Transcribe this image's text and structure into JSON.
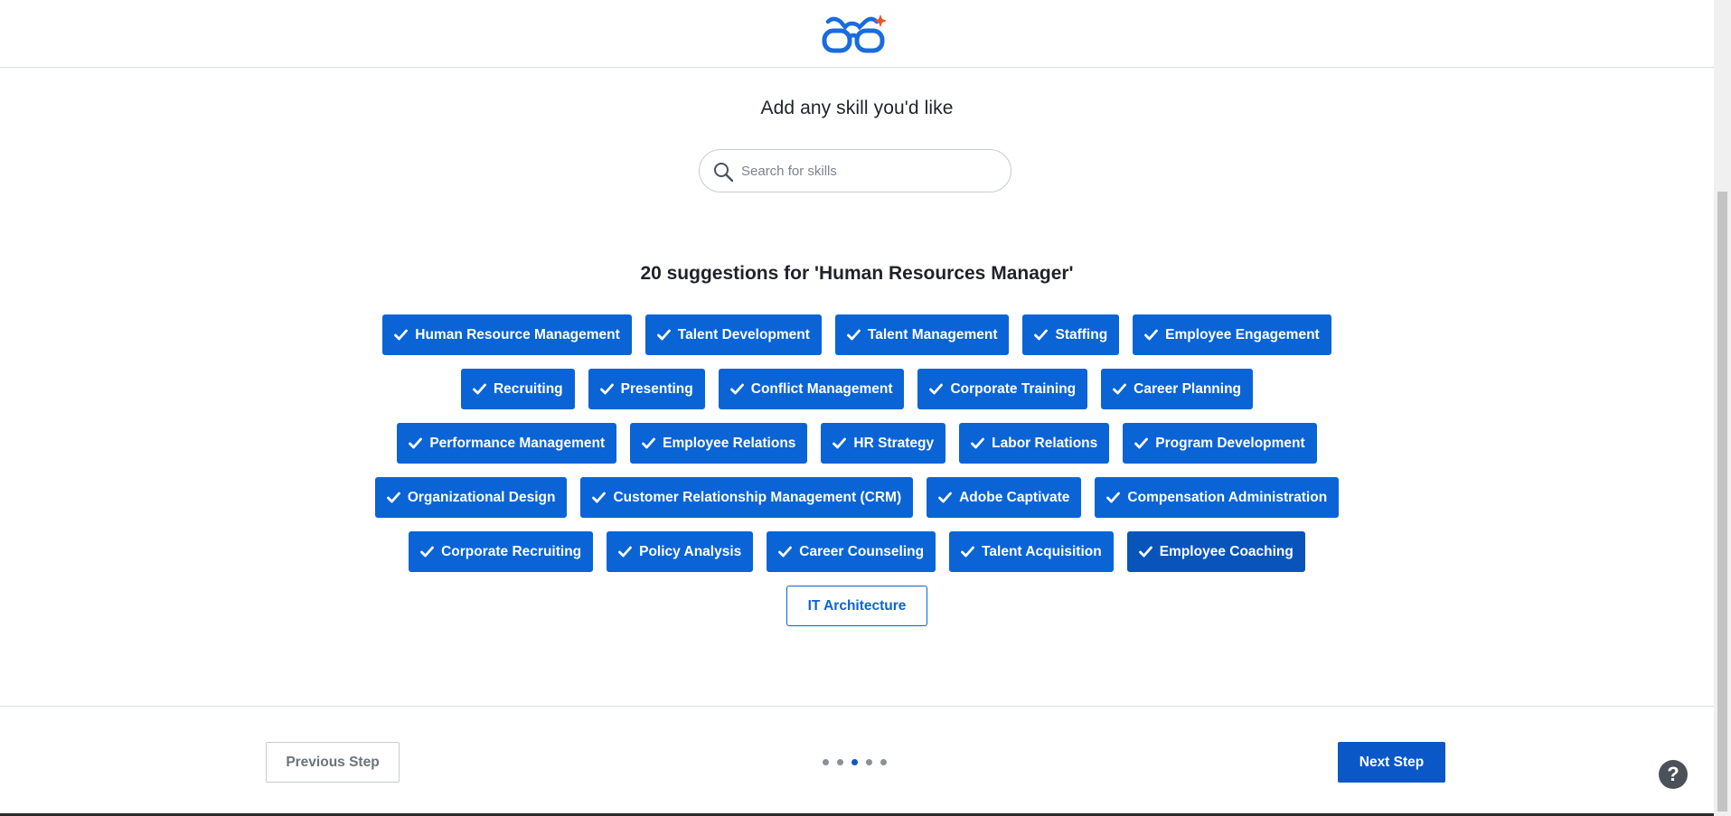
{
  "header": {
    "logo": "glasses-logo-icon"
  },
  "main": {
    "title": "Add any skill you'd like",
    "search": {
      "placeholder": "Search for skills",
      "value": ""
    },
    "suggestions_heading": "20 suggestions for 'Human Resources Manager'",
    "rows": [
      [
        {
          "label": "Human Resource Management",
          "selected": true
        },
        {
          "label": "Talent Development",
          "selected": true
        },
        {
          "label": "Talent Management",
          "selected": true
        },
        {
          "label": "Staffing",
          "selected": true
        },
        {
          "label": "Employee Engagement",
          "selected": true
        }
      ],
      [
        {
          "label": "Recruiting",
          "selected": true
        },
        {
          "label": "Presenting",
          "selected": true
        },
        {
          "label": "Conflict Management",
          "selected": true
        },
        {
          "label": "Corporate Training",
          "selected": true
        },
        {
          "label": "Career Planning",
          "selected": true
        }
      ],
      [
        {
          "label": "Performance Management",
          "selected": true
        },
        {
          "label": "Employee Relations",
          "selected": true
        },
        {
          "label": "HR Strategy",
          "selected": true
        },
        {
          "label": "Labor Relations",
          "selected": true
        },
        {
          "label": "Program Development",
          "selected": true
        }
      ],
      [
        {
          "label": "Organizational Design",
          "selected": true
        },
        {
          "label": "Customer Relationship Management (CRM)",
          "selected": true
        },
        {
          "label": "Adobe Captivate",
          "selected": true
        },
        {
          "label": "Compensation Administration",
          "selected": true
        }
      ],
      [
        {
          "label": "Corporate Recruiting",
          "selected": true
        },
        {
          "label": "Policy Analysis",
          "selected": true
        },
        {
          "label": "Career Counseling",
          "selected": true
        },
        {
          "label": "Talent Acquisition",
          "selected": true
        },
        {
          "label": "Employee Coaching",
          "selected": true,
          "focused": true
        }
      ],
      [
        {
          "label": "IT Architecture",
          "selected": false
        }
      ]
    ]
  },
  "footer": {
    "previous_label": "Previous Step",
    "next_label": "Next Step",
    "steps_total": 5,
    "current_step": 3,
    "help_label": "?"
  },
  "colors": {
    "accent": "#0a64d6",
    "accent_dark": "#0854bb",
    "logo_blue": "#1a6be0",
    "logo_orange": "#e8562a"
  }
}
